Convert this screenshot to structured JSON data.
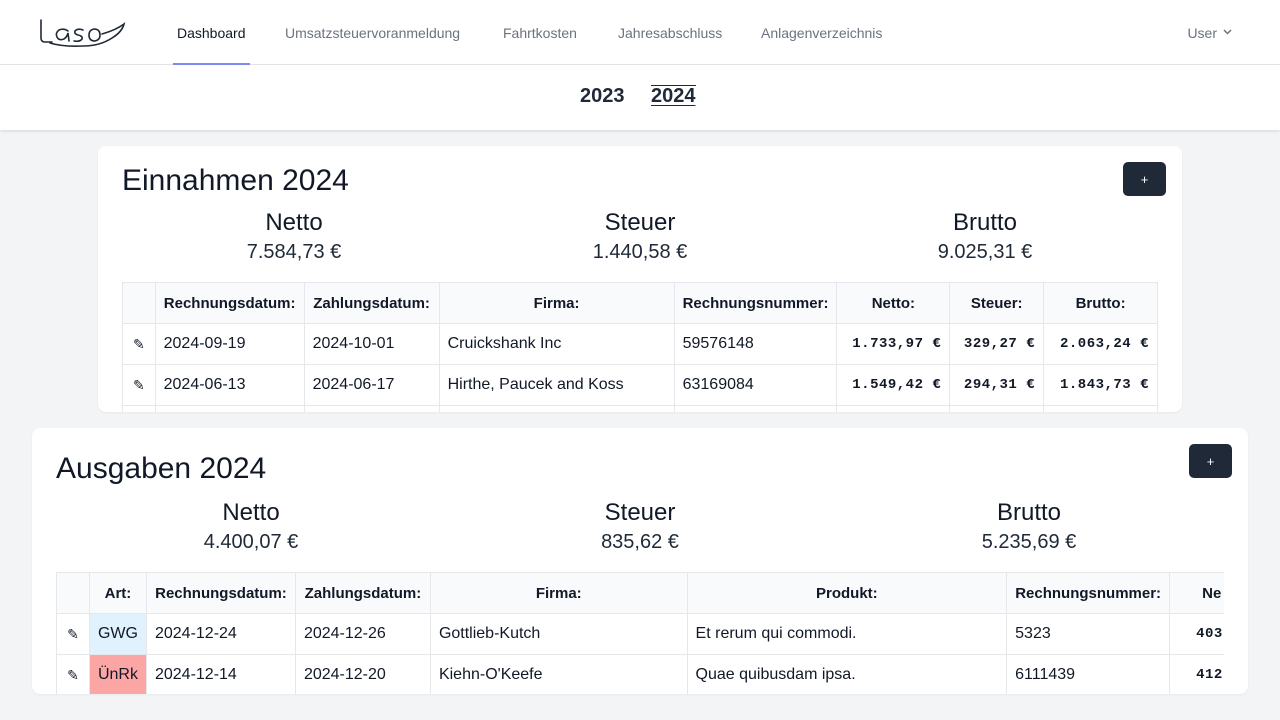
{
  "nav": {
    "logo_text": "Laso",
    "links": [
      "Dashboard",
      "Umsatzsteuervoranmeldung",
      "Fahrtkosten",
      "Jahresabschluss",
      "Anlagenverzeichnis"
    ],
    "user_label": "User"
  },
  "years": [
    "2023",
    "2024"
  ],
  "selected_year": "2024",
  "einnahmen": {
    "title": "Einnahmen 2024",
    "add_label": "+",
    "summary": [
      {
        "label": "Netto",
        "value": "7.584,73 €"
      },
      {
        "label": "Steuer",
        "value": "1.440,58 €"
      },
      {
        "label": "Brutto",
        "value": "9.025,31 €"
      }
    ],
    "columns": [
      "",
      "Rechnungsdatum:",
      "Zahlungsdatum:",
      "Firma:",
      "Rechnungsnummer:",
      "Netto:",
      "Steuer:",
      "Brutto:"
    ],
    "rows": [
      {
        "rechnungsdatum": "2024-09-19",
        "zahlungsdatum": "2024-10-01",
        "firma": "Cruickshank Inc",
        "nummer": "59576148",
        "netto": "1.733,97 €",
        "steuer": "329,27 €",
        "brutto": "2.063,24 €"
      },
      {
        "rechnungsdatum": "2024-06-13",
        "zahlungsdatum": "2024-06-17",
        "firma": "Hirthe, Paucek and Koss",
        "nummer": "63169084",
        "netto": "1.549,42 €",
        "steuer": "294,31 €",
        "brutto": "1.843,73 €"
      }
    ]
  },
  "ausgaben": {
    "title": "Ausgaben 2024",
    "add_label": "+",
    "summary": [
      {
        "label": "Netto",
        "value": "4.400,07 €"
      },
      {
        "label": "Steuer",
        "value": "835,62 €"
      },
      {
        "label": "Brutto",
        "value": "5.235,69 €"
      }
    ],
    "columns": [
      "",
      "Art:",
      "Rechnungsdatum:",
      "Zahlungsdatum:",
      "Firma:",
      "Produkt:",
      "Rechnungsnummer:",
      "Ne"
    ],
    "rows": [
      {
        "art": "GWG",
        "rechnungsdatum": "2024-12-24",
        "zahlungsdatum": "2024-12-26",
        "firma": "Gottlieb-Kutch",
        "produkt": "Et rerum qui commodi.",
        "nummer": "5323",
        "netto": "403"
      },
      {
        "art": "ÜnRk",
        "rechnungsdatum": "2024-12-14",
        "zahlungsdatum": "2024-12-20",
        "firma": "Kiehn-O'Keefe",
        "produkt": "Quae quibusdam ipsa.",
        "nummer": "6111439",
        "netto": "412"
      }
    ]
  },
  "icons": {
    "edit": "pencil-icon",
    "user_dropdown": "chevron-down-icon"
  },
  "colors": {
    "accent": "#818cf8",
    "button": "#1f2937",
    "tag_gwg": "#e0f2fe",
    "tag_unrk": "#fca5a5"
  }
}
